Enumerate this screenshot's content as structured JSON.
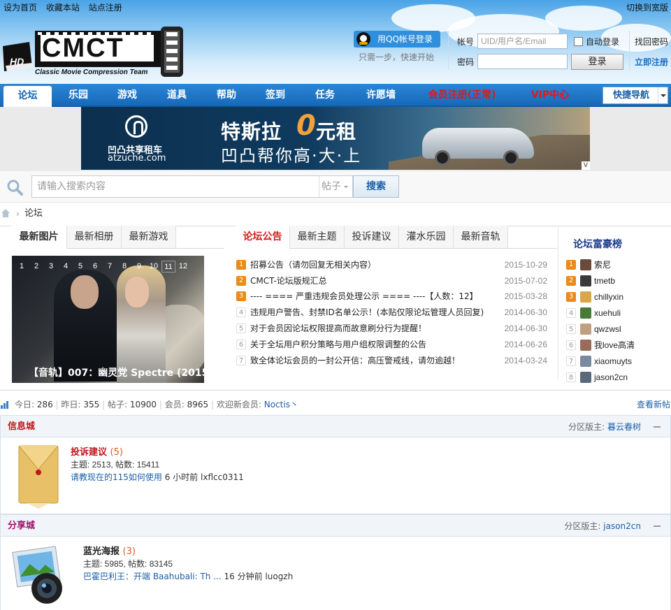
{
  "topbar": {
    "set_home": "设为首页",
    "bookmark": "收藏本站",
    "register": "站点注册",
    "widescreen": "切换到宽版"
  },
  "logo": {
    "text": "CMCT",
    "badge": "HD",
    "subtitle": "Classic Movie Compression Team"
  },
  "login": {
    "qq_button": "用QQ帐号登录",
    "qq_hint": "只需一步，快速开始",
    "account_label": "帐号",
    "account_placeholder": "UID/用户名/Email",
    "password_label": "密码",
    "auto_login": "自动登录",
    "login_button": "登录",
    "forgot": "找回密码",
    "register_now": "立即注册"
  },
  "nav": {
    "items": [
      "论坛",
      "乐园",
      "游戏",
      "道具",
      "帮助",
      "签到",
      "任务",
      "许愿墙",
      "会员注册(正常)",
      "VIP中心"
    ],
    "quick_nav": "快捷导航"
  },
  "banner": {
    "brand": "凹凸共享租车",
    "url": "atzuche.com",
    "line1_pre": "特斯拉",
    "zero": "0",
    "line1_post": "元租",
    "line2": "凹凸帮你高·大·上",
    "v_mark": "V"
  },
  "search": {
    "placeholder": "请输入搜索内容",
    "type": "帖子",
    "button": "搜索"
  },
  "breadcrumb": {
    "sep": "›",
    "forum": "论坛"
  },
  "image_tabs": [
    "最新图片",
    "最新相册",
    "最新游戏"
  ],
  "carousel": {
    "pages": [
      "1",
      "2",
      "3",
      "4",
      "5",
      "6",
      "7",
      "8",
      "9",
      "10",
      "11",
      "12"
    ],
    "active_page": "11",
    "caption": "【音轨】007：幽灵党 Spectre (2015"
  },
  "notice_tabs": [
    "论坛公告",
    "最新主题",
    "投诉建议",
    "灌水乐园",
    "最新音轨"
  ],
  "notices": [
    {
      "num": "1",
      "title": "招募公告（请勿回复无相关内容）",
      "date": "2015-10-29"
    },
    {
      "num": "2",
      "title": "CMCT-论坛版规汇总",
      "date": "2015-07-02"
    },
    {
      "num": "3",
      "title": "---- ==== 严重违规会员处理公示 ==== ----【人数：12】",
      "date": "2015-03-28"
    },
    {
      "num": "4",
      "title": "违规用户警告、封禁ID名单公示！(本贴仅限论坛管理人员回复)",
      "date": "2014-06-30"
    },
    {
      "num": "5",
      "title": "对于会员因论坛权限提高而故意刷分行为提醒！",
      "date": "2014-06-30"
    },
    {
      "num": "6",
      "title": "关于全坛用户积分策略与用户组权限调整的公告",
      "date": "2014-06-26"
    },
    {
      "num": "7",
      "title": "致全体论坛会员的一封公开信：高压警戒线，请勿逾越！",
      "date": "2014-03-24"
    }
  ],
  "rich_list": {
    "title": "论坛富豪榜",
    "users": [
      {
        "num": "1",
        "name": "索尼",
        "color": "#6a4a3a"
      },
      {
        "num": "2",
        "name": "tmetb",
        "color": "#3a3a3a"
      },
      {
        "num": "3",
        "name": "chillyxin",
        "color": "#d9a64a"
      },
      {
        "num": "4",
        "name": "xuehuli",
        "color": "#4a7a3a"
      },
      {
        "num": "5",
        "name": "qwzwsl",
        "color": "#c0a080"
      },
      {
        "num": "6",
        "name": "我love高清",
        "color": "#9a6a5a"
      },
      {
        "num": "7",
        "name": "xiaomuyts",
        "color": "#7a8aa0"
      },
      {
        "num": "8",
        "name": "jason2cn",
        "color": "#5a6a7a"
      }
    ]
  },
  "stats": {
    "today_label": "今日:",
    "today": "286",
    "yesterday_label": "昨日:",
    "yesterday": "355",
    "posts_label": "帖子:",
    "posts": "10900",
    "members_label": "会员:",
    "members": "8965",
    "welcome_label": "欢迎新会员:",
    "newest": "Noctis丶",
    "view_new": "查看新帖"
  },
  "sections": [
    {
      "title": "信息城",
      "title_color": "#c0161c",
      "mod_label": "分区版主:",
      "moderator": "暮云春树",
      "forum": {
        "name": "投诉建议",
        "count": "(5)",
        "name_color": "#c0161c",
        "stats": "主题: 2513, 帖数: 15411",
        "last_link": "请教现在的115如何使用",
        "last_time": "6 小时前",
        "last_user": "lxflcc0311"
      }
    },
    {
      "title": "分享城",
      "title_color": "#a0106a",
      "mod_label": "分区版主:",
      "moderator": "jason2cn",
      "forum": {
        "name": "蓝光海报",
        "count": "(3)",
        "name_color": "#222",
        "stats": "主题: 5985, 帖数: 83145",
        "last_link": "巴霍巴利王：开端  Baahubali: Th ...",
        "last_time": "16 分钟前",
        "last_user": "luogzh"
      }
    }
  ]
}
